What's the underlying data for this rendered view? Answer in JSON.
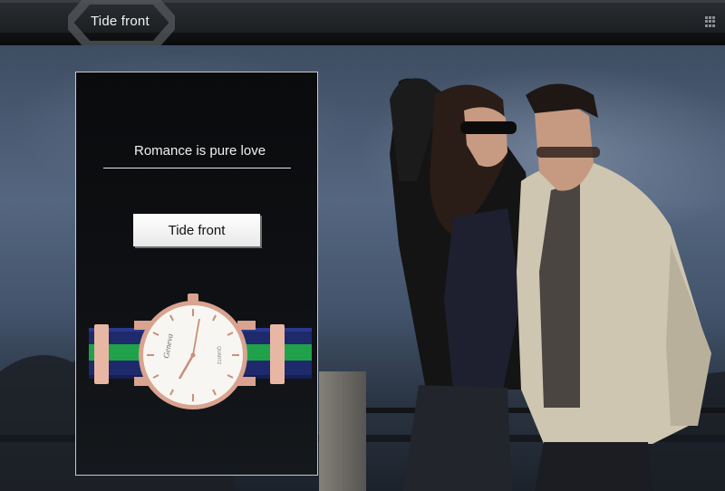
{
  "header": {
    "title": "Tide front",
    "menu_icon": "grid-icon"
  },
  "banner": {
    "heading": "Romance is pure love",
    "button_label": "Tide front",
    "watch_brand": "Geneva",
    "watch_dial_text": "QUARTZ"
  },
  "colors": {
    "accent": "#1fa24a",
    "strap_blue": "#1e2a6b",
    "rose_gold": "#d9a38f"
  }
}
